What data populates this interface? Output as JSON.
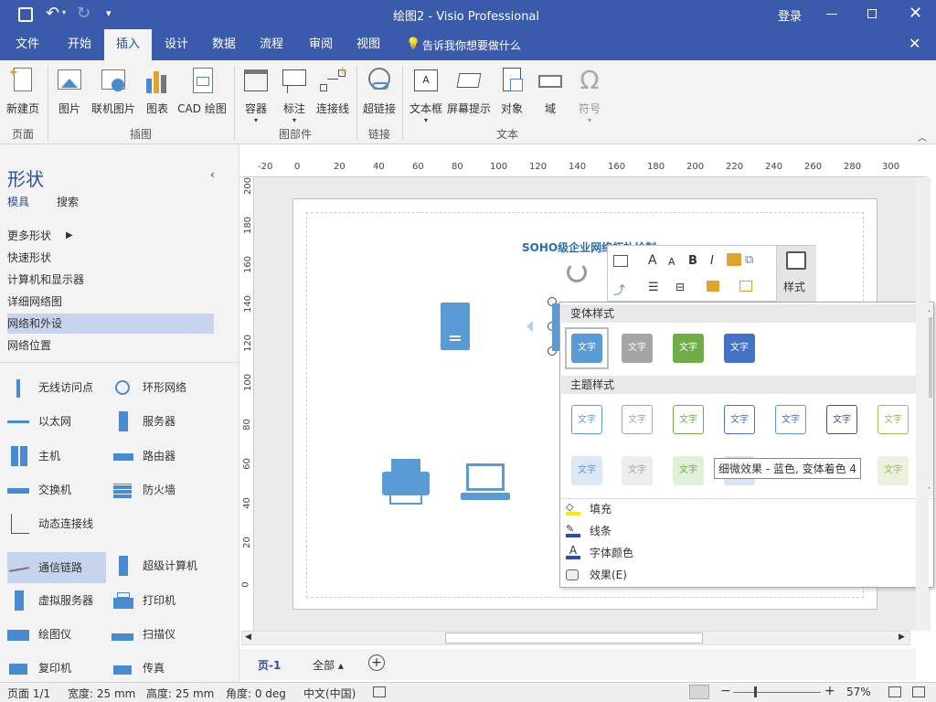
{
  "titlebar": {
    "title": "绘图2 - Visio Professional",
    "login": "登录"
  },
  "tabs": [
    {
      "label": "文件"
    },
    {
      "label": "开始"
    },
    {
      "label": "插入"
    },
    {
      "label": "设计"
    },
    {
      "label": "数据"
    },
    {
      "label": "流程"
    },
    {
      "label": "审阅"
    },
    {
      "label": "视图"
    }
  ],
  "tellme": "告诉我你想要做什么",
  "ribbon": {
    "buttons": [
      "新建页",
      "图片",
      "联机图片",
      "图表",
      "CAD 绘图",
      "容器",
      "标注",
      "连接线",
      "超链接",
      "文本框",
      "屏幕提示",
      "对象",
      "域",
      "符号"
    ],
    "groups": [
      "页面",
      "插图",
      "图部件",
      "链接",
      "文本"
    ]
  },
  "shapes_pane": {
    "title": "形状",
    "tab_stencils": "模具",
    "tab_search": "搜索",
    "stencils": [
      "更多形状",
      "快速形状",
      "计算机和显示器",
      "详细网络图",
      "网络和外设",
      "网络位置"
    ],
    "shapes": [
      "无线访问点",
      "环形网络",
      "以太网",
      "服务器",
      "主机",
      "路由器",
      "交换机",
      "防火墙",
      "动态连接线",
      "通信链路",
      "超级计算机",
      "虚拟服务器",
      "打印机",
      "绘图仪",
      "扫描仪",
      "复印机",
      "传真"
    ]
  },
  "ruler_h": [
    "-20",
    "0",
    "20",
    "40",
    "60",
    "80",
    "100",
    "120",
    "140",
    "160",
    "180",
    "200",
    "220",
    "240",
    "260",
    "280",
    "300"
  ],
  "ruler_v": [
    "200",
    "180",
    "160",
    "140",
    "120",
    "100",
    "80",
    "60",
    "40",
    "20",
    "0"
  ],
  "drawing": {
    "title": "SOHO级企业网络拓扑绘制"
  },
  "mini_toolbar": {
    "font_a": "A",
    "bold": "B",
    "italic": "I",
    "style_label": "样式"
  },
  "style_popup": {
    "variant_header": "变体样式",
    "theme_header": "主题样式",
    "swatch_text": "文字",
    "variant_colors": [
      "#5b9bd5",
      "#a5a5a5",
      "#70ad47",
      "#4472c4"
    ],
    "theme_colors": [
      "#5b9bd5",
      "#a5a5a5",
      "#70ad47",
      "#4472c4",
      "#5b9bd5",
      "#44546a",
      "#9bbb59"
    ],
    "tooltip": "细微效果 - 蓝色, 变体着色 4",
    "menu": [
      "填充",
      "线条",
      "字体颜色",
      "效果(E)"
    ]
  },
  "page_tabs": {
    "page1": "页-1",
    "all": "全部"
  },
  "status": {
    "page": "页面 1/1",
    "width": "宽度: 25 mm",
    "height": "高度: 25 mm",
    "angle": "角度: 0 deg",
    "lang": "中文(中国)",
    "zoom": "57%"
  }
}
